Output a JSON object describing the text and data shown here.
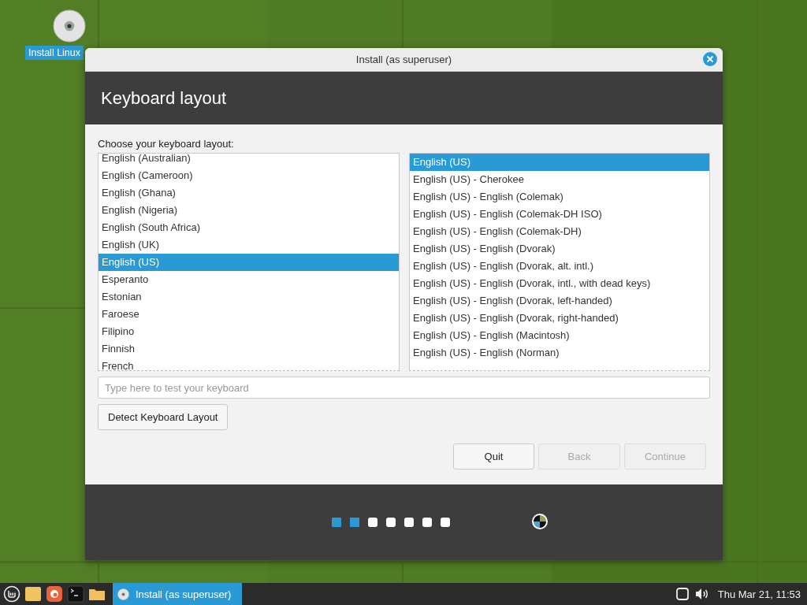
{
  "desktop_icon": {
    "label": "Install Linux",
    "selected": true
  },
  "window": {
    "title": "Install (as superuser)",
    "heading": "Keyboard layout"
  },
  "prompt": "Choose your keyboard layout:",
  "layouts": [
    {
      "label": "English (Australian)",
      "selected": false
    },
    {
      "label": "English (Cameroon)",
      "selected": false
    },
    {
      "label": "English (Ghana)",
      "selected": false
    },
    {
      "label": "English (Nigeria)",
      "selected": false
    },
    {
      "label": "English (South Africa)",
      "selected": false
    },
    {
      "label": "English (UK)",
      "selected": false
    },
    {
      "label": "English (US)",
      "selected": true
    },
    {
      "label": "Esperanto",
      "selected": false
    },
    {
      "label": "Estonian",
      "selected": false
    },
    {
      "label": "Faroese",
      "selected": false
    },
    {
      "label": "Filipino",
      "selected": false
    },
    {
      "label": "Finnish",
      "selected": false
    },
    {
      "label": "French",
      "selected": false
    }
  ],
  "variants": [
    {
      "label": "English (US)",
      "selected": true
    },
    {
      "label": "English (US) - Cherokee",
      "selected": false
    },
    {
      "label": "English (US) - English (Colemak)",
      "selected": false
    },
    {
      "label": "English (US) - English (Colemak-DH ISO)",
      "selected": false
    },
    {
      "label": "English (US) - English (Colemak-DH)",
      "selected": false
    },
    {
      "label": "English (US) - English (Dvorak)",
      "selected": false
    },
    {
      "label": "English (US) - English (Dvorak, alt. intl.)",
      "selected": false
    },
    {
      "label": "English (US) - English (Dvorak, intl., with dead keys)",
      "selected": false
    },
    {
      "label": "English (US) - English (Dvorak, left-handed)",
      "selected": false
    },
    {
      "label": "English (US) - English (Dvorak, right-handed)",
      "selected": false
    },
    {
      "label": "English (US) - English (Macintosh)",
      "selected": false
    },
    {
      "label": "English (US) - English (Norman)",
      "selected": false
    }
  ],
  "test_field": {
    "placeholder": "Type here to test your keyboard"
  },
  "detect_button": "Detect Keyboard Layout",
  "buttons": [
    {
      "label": "Quit",
      "disabled": false
    },
    {
      "label": "Back",
      "disabled": true
    },
    {
      "label": "Continue",
      "disabled": true
    }
  ],
  "progress": [
    {
      "done": true
    },
    {
      "done": true
    },
    {
      "done": false
    },
    {
      "done": false
    },
    {
      "done": false
    },
    {
      "done": false
    },
    {
      "done": false
    }
  ],
  "taskbar": {
    "window_button": {
      "label": "Install (as superuser)",
      "active": true
    },
    "clock": "Thu Mar 21, 11:53"
  }
}
